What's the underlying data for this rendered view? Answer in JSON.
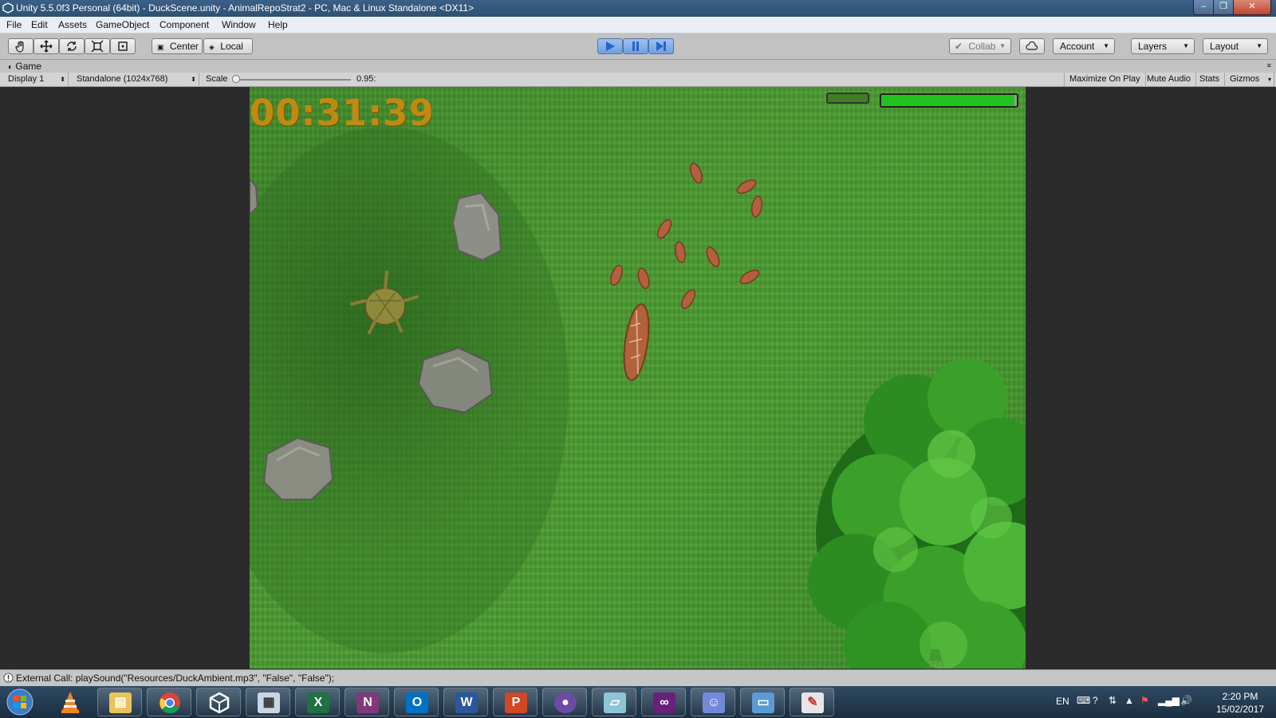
{
  "window": {
    "title": "Unity 5.5.0f3 Personal (64bit) - DuckScene.unity - AnimalRepoStrat2 - PC, Mac & Linux Standalone <DX11>",
    "controls": {
      "minimize": "–",
      "maximize": "❐",
      "close": "✕"
    }
  },
  "menu": [
    "File",
    "Edit",
    "Assets",
    "GameObject",
    "Component",
    "Window",
    "Help"
  ],
  "toolbar": {
    "tools": [
      "hand-icon",
      "move-icon",
      "rotate-icon",
      "scale-icon",
      "rect-icon"
    ],
    "pivot": "Center",
    "space": "Local",
    "play": "play-icon",
    "pause": "pause-icon",
    "step": "step-icon",
    "collab": "Collab",
    "account": "Account",
    "layers": "Layers",
    "layout": "Layout"
  },
  "game_view": {
    "tab": "Game",
    "display": "Display 1",
    "resolution": "Standalone (1024x768)",
    "scale_label": "Scale",
    "scale_value": "0.95:",
    "maximize": "Maximize On Play",
    "mute": "Mute Audio",
    "stats": "Stats",
    "gizmos": "Gizmos",
    "timer": "00:31:39",
    "health_fill": 0.98,
    "colors": {
      "grass": "#4a9a30",
      "timer": "#c08a12",
      "health": "#22c21f"
    }
  },
  "status": {
    "message": "External Call: playSound(\"Resources/DuckAmbient.mp3\", \"False\", \"False\");"
  },
  "taskbar": {
    "apps": [
      "windows-start-icon",
      "vlc-icon",
      "file-explorer-icon",
      "chrome-icon",
      "unity-icon",
      "calculator-icon",
      "excel-icon",
      "onenote-icon",
      "outlook-icon",
      "word-icon",
      "powerpoint-icon",
      "github-icon",
      "notepad-icon",
      "visual-studio-icon",
      "discord-icon",
      "photos-icon",
      "paint-icon"
    ],
    "tray_lang": "EN",
    "time": "2:20 PM",
    "date": "15/02/2017"
  }
}
